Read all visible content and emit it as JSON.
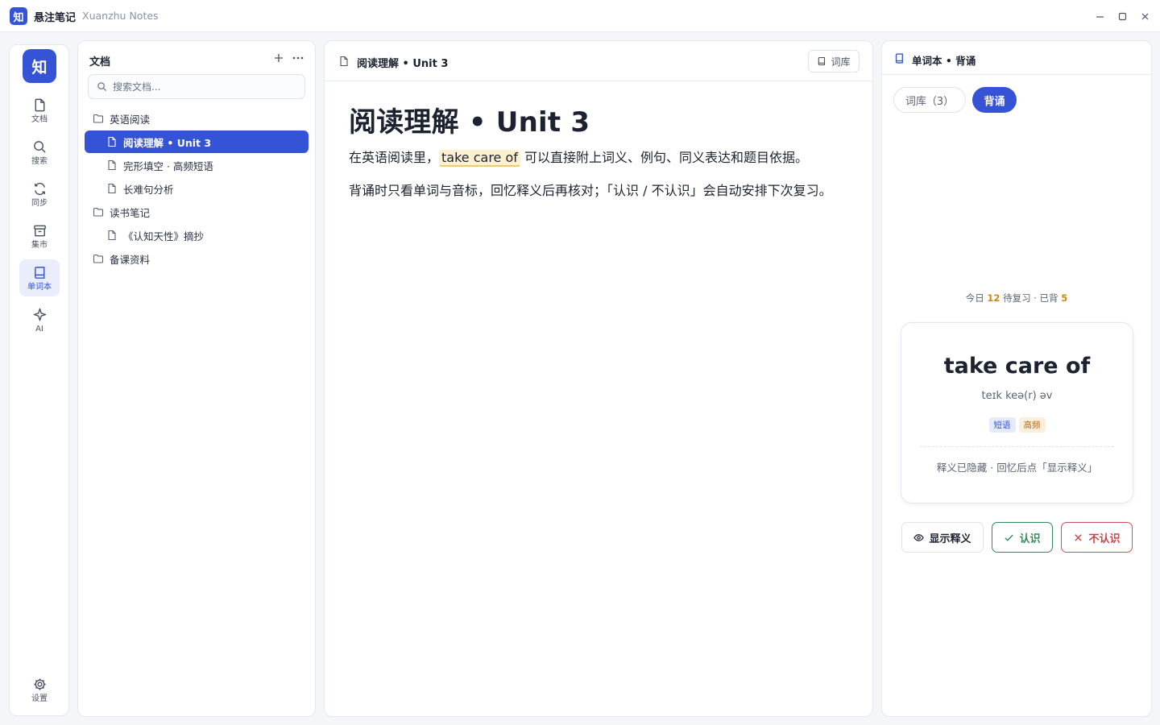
{
  "window": {
    "logo_char": "知",
    "title": "悬注笔记",
    "subtitle": "Xuanzhu Notes"
  },
  "rail": {
    "logo_char": "知",
    "items": [
      {
        "label": "文档",
        "icon": "document-icon"
      },
      {
        "label": "搜索",
        "icon": "search-icon"
      },
      {
        "label": "同步",
        "icon": "sync-icon"
      },
      {
        "label": "集市",
        "icon": "market-icon"
      },
      {
        "label": "单词本",
        "icon": "book-icon",
        "active": true
      },
      {
        "label": "AI",
        "icon": "sparkle-icon"
      }
    ],
    "settings_label": "设置"
  },
  "docs": {
    "title": "文档",
    "search_placeholder": "搜索文档...",
    "tree": [
      {
        "type": "folder",
        "label": "英语阅读"
      },
      {
        "type": "file",
        "label": "阅读理解 • Unit 3",
        "selected": true
      },
      {
        "type": "file",
        "label": "完形填空 · 高频短语"
      },
      {
        "type": "file",
        "label": "长难句分析"
      },
      {
        "type": "folder",
        "label": "读书笔记"
      },
      {
        "type": "file",
        "label": "《认知天性》摘抄"
      },
      {
        "type": "folder",
        "label": "备课资料"
      }
    ]
  },
  "editor": {
    "tab_title": "阅读理解 • Unit 3",
    "lexicon_button": "词库",
    "heading": "阅读理解 • Unit 3",
    "para1_before": "在英语阅读里，",
    "para1_highlight": "take care of",
    "para1_after": "可以直接附上词义、例句、同义表达和题目依据。",
    "para2": "背诵时只看单词与音标，回忆释义后再核对；「认识 / 不认识」会自动安排下次复习。"
  },
  "vocab": {
    "header_title": "单词本 • 背诵",
    "seg_lexicon": "词库（3）",
    "seg_recite": "背诵",
    "stats": {
      "prefix": "今日",
      "due": "12",
      "middle": "待复习 · 已背",
      "done": "5"
    },
    "card": {
      "word": "take care of",
      "phonetic": "teɪk keə(r) əv",
      "tags": [
        "短语",
        "高频"
      ],
      "hint": "释义已隐藏 · 回忆后点「显示释义」"
    },
    "actions": {
      "show": "显示释义",
      "know": "认识",
      "unknown": "不认识"
    }
  },
  "colors": {
    "accent": "#3553d6",
    "highlight": "#fdf1cf",
    "know": "#2f8a5a",
    "unknown": "#c8424c",
    "stat_number": "#c98a12"
  }
}
